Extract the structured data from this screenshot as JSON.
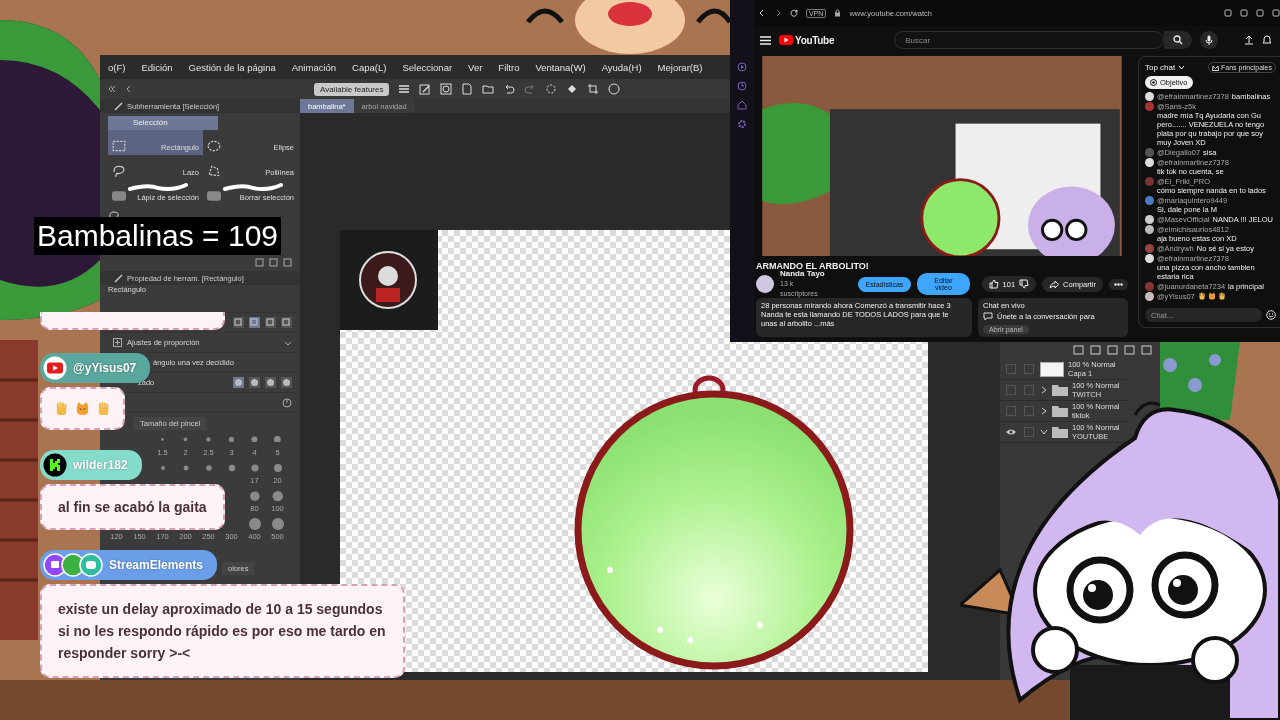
{
  "counter": {
    "label": "Bambalinas = 109"
  },
  "art_app": {
    "menu": [
      "o(F)",
      "Edición",
      "Gestión de la página",
      "Animación",
      "Capa(L)",
      "Seleccionar",
      "Ver",
      "Filtro",
      "Ventana(W)",
      "Ayuda(H)",
      "Mejorar(B)"
    ],
    "toolbar": {
      "features_button": "Available features"
    },
    "tabs": [
      {
        "label": "bambalina*",
        "selected": true
      },
      {
        "label": "arbol navidad",
        "selected": false
      }
    ],
    "subtool_panel": {
      "title": "Subherramienta [Selección]",
      "group": "Selección",
      "tools": [
        {
          "label": "Rectángulo",
          "selected": true
        },
        {
          "label": "Elipse",
          "selected": false
        },
        {
          "label": "Lazo",
          "selected": false
        },
        {
          "label": "Polilínea",
          "selected": false
        },
        {
          "label": "Lápiz de selección",
          "selected": false
        },
        {
          "label": "Borrar selección",
          "selected": false
        }
      ]
    },
    "property_panel": {
      "title": "Propiedad de herram. [Rectángulo]",
      "subtitle": "Rectángulo",
      "options": [
        "Ajustes de proporción",
        "ángulo una vez decidido",
        "zado"
      ]
    },
    "brush_size": {
      "title": "Tamaño del pincel",
      "rows": [
        [
          "",
          "",
          "1.5",
          "2",
          "2.5",
          "3",
          "4",
          "5"
        ],
        [
          "",
          "",
          "",
          "",
          "",
          "",
          "17",
          "20"
        ],
        [
          "",
          "",
          "",
          "",
          "",
          "",
          "80",
          "100"
        ],
        [
          "120",
          "150",
          "170",
          "200",
          "250",
          "300",
          "400",
          "500"
        ]
      ],
      "next_tab": "olores"
    },
    "layers": [
      {
        "kind": "layer",
        "blend": "100 % Normal",
        "name": "Capa 1",
        "visible": false
      },
      {
        "kind": "folder",
        "blend": "100 % Normal",
        "name": "TWITCH",
        "visible": false,
        "expanded": false
      },
      {
        "kind": "folder",
        "blend": "100 % Normal",
        "name": "tiktok",
        "visible": false,
        "expanded": false
      },
      {
        "kind": "folder",
        "blend": "100 % Normal",
        "name": "YOUTUBE",
        "visible": true,
        "expanded": true
      }
    ]
  },
  "browser": {
    "vpn_badge": "VPN",
    "url": "www.youtube.com/watch",
    "logo": "YouTube",
    "search_placeholder": "Buscar",
    "video": {
      "title": "ARMANDO EL ARBOLITO!",
      "channel": "Nanda Tayo",
      "subscribers": "13 k suscriptores",
      "buttons": [
        "Estadísticas",
        "Editar video"
      ],
      "likes": "101",
      "share": "Compartir",
      "description": {
        "stats": "28 personas mirando ahora  Comenzó a transmitir hace 3",
        "text": "Nanda te esta llamando DE TODOS LADOS para que te unas al arbolito",
        "more": "...más"
      }
    },
    "chat_card": {
      "title": "Chat en vivo",
      "text": "Únete a la conversación para",
      "button": "Abrir panel"
    },
    "chat": {
      "title": "Top chat",
      "filter": "Fans principales",
      "goal": "Objetivo",
      "placeholder": "Chat...",
      "messages": [
        {
          "kind": "text",
          "user": "@efrainmartinez7378",
          "text": "bambalinas"
        },
        {
          "kind": "text",
          "user": "@Sans-z5k",
          "text": "madre mía Tq Ayudaria con Gu pero....... VENEZUELA no tengo plata por qu trabajo por que soy muy Joven XD"
        },
        {
          "kind": "text",
          "user": "@Diegallo07",
          "text": "sisa"
        },
        {
          "kind": "text",
          "user": "@efrainmartinez7378",
          "text": "tik tok no cuenta, se"
        },
        {
          "kind": "text",
          "user": "@El_Friki_PRO",
          "text": "cómo siempre nanda en to lados"
        },
        {
          "kind": "text",
          "user": "@mariaquintero9449",
          "text": "Si, dale pone la M"
        },
        {
          "kind": "text",
          "user": "@MasevOfficial",
          "text": "NANDA !!! JELOU"
        },
        {
          "kind": "text",
          "user": "@elmichisaurios4812",
          "text": "aja bueno estas con XD"
        },
        {
          "kind": "text",
          "user": "@Andrywh",
          "text": "No sé si ya estoy"
        },
        {
          "kind": "text",
          "user": "@efrainmartinez7378",
          "text": "una pizza con ancho tambien estaria rica"
        },
        {
          "kind": "text",
          "user": "@juanurdaneta7234",
          "text": "la principal"
        },
        {
          "kind": "emotes",
          "user": "@yYisus07"
        }
      ]
    }
  },
  "stream_chat": [
    {
      "kind": "youtube",
      "user": "@yYisus07"
    },
    {
      "kind": "kick",
      "user": "wilder182",
      "text": "al fin se acabó la gaita"
    },
    {
      "kind": "multi",
      "user": "StreamElements",
      "text": "existe un delay aproximado de 10 a 15 segundos si no les respondo rápido es por eso me tardo en responder sorry >-<"
    }
  ]
}
